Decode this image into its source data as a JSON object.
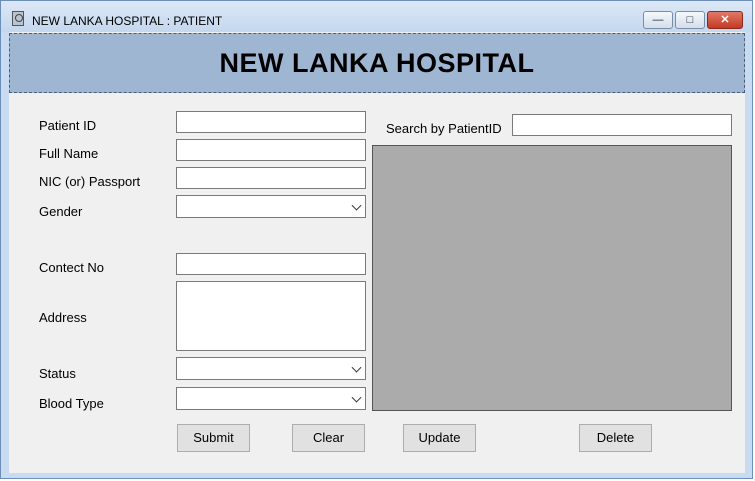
{
  "window": {
    "title": "NEW LANKA HOSPITAL : PATIENT"
  },
  "header": {
    "title": "NEW LANKA HOSPITAL"
  },
  "form": {
    "patient_id_label": "Patient ID",
    "full_name_label": "Full Name",
    "nic_label": "NIC (or) Passport",
    "gender_label": "Gender",
    "contact_label": "Contect No",
    "address_label": "Address",
    "status_label": "Status",
    "blood_type_label": "Blood Type",
    "patient_id_value": "",
    "full_name_value": "",
    "nic_value": "",
    "contact_value": "",
    "address_value": ""
  },
  "search": {
    "label": "Search by PatientID",
    "value": ""
  },
  "buttons": {
    "submit": "Submit",
    "clear": "Clear",
    "update": "Update",
    "delete": "Delete"
  },
  "controls": {
    "minimize": "—",
    "maximize": "□",
    "close": "✕"
  },
  "icons": {
    "app": "hospital-app-icon"
  }
}
